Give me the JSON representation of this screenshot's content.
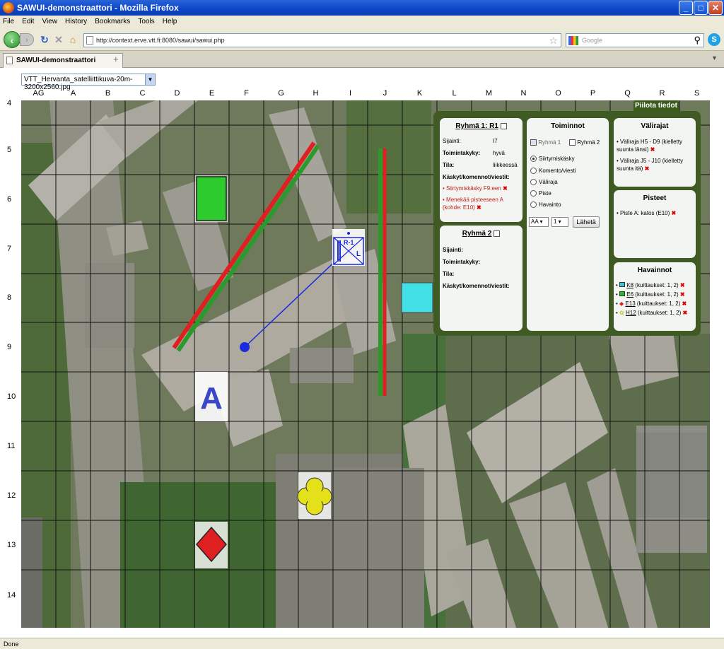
{
  "window": {
    "title": "SAWUI-demonstraattori - Mozilla Firefox",
    "min": "_",
    "max": "□",
    "close": "✕"
  },
  "menu": [
    "File",
    "Edit",
    "View",
    "History",
    "Bookmarks",
    "Tools",
    "Help"
  ],
  "nav": {
    "url": "http://context.erve.vtt.fi:8080/sawui/sawui.php",
    "search_placeholder": "Google"
  },
  "tab": {
    "label": "SAWUI-demonstraattori",
    "new_tab": "+"
  },
  "map_select": {
    "value": "VTT_Hervanta_satelliittikuva-20m-3200x2560.jpg"
  },
  "grid": {
    "columns": [
      "AG",
      "A",
      "B",
      "C",
      "D",
      "E",
      "F",
      "G",
      "H",
      "I",
      "J",
      "K",
      "L",
      "M",
      "N",
      "O",
      "P",
      "Q",
      "R",
      "S"
    ],
    "rows": [
      "4",
      "5",
      "6",
      "7",
      "8",
      "9",
      "10",
      "11",
      "12",
      "13",
      "14"
    ]
  },
  "panel": {
    "hide_label": "Piilota tiedot",
    "group1": {
      "title": "Ryhmä 1: R1",
      "location_label": "Sijainti:",
      "location": "I7",
      "capacity_label": "Toimintakyky:",
      "capacity": "hyvä",
      "state_label": "Tila:",
      "state": "liikkeessä",
      "orders_label": "Käskyt/komennot/viestit:",
      "orders": [
        "Siirtymiskäsky F9:een",
        "Menekää pisteeseen A (kohde: E10)"
      ]
    },
    "group2": {
      "title": "Ryhmä 2",
      "location_label": "Sijainti:",
      "capacity_label": "Toimintakyky:",
      "state_label": "Tila:",
      "orders_label": "Käskyt/komennot/viestit:"
    },
    "actions": {
      "title": "Toiminnot",
      "group1": "Ryhmä 1",
      "group2": "Ryhmä 2",
      "options": [
        "Siirtymiskäsky",
        "Komento/viesti",
        "Väliraja",
        "Piste",
        "Havainto"
      ],
      "col": "AA",
      "row": "1",
      "send": "Lähetä"
    },
    "boundaries": {
      "title": "Välirajat",
      "items": [
        "Väliraja H5 - D9 (kielletty suunta länsi)",
        "Väliraja J5 - J10 (kielletty suunta itä)"
      ]
    },
    "points": {
      "title": "Pisteet",
      "items": [
        "Piste A: katos (E10)"
      ]
    },
    "observations": {
      "title": "Havainnot",
      "items": [
        {
          "code": "K8",
          "text": "(kuittaukset: 1, 2)",
          "color": "#33cccc"
        },
        {
          "code": "E6",
          "text": "(kuittaukset: 1, 2)",
          "color": "#22bb22"
        },
        {
          "code": "E13",
          "text": "(kuittaukset: 1, 2)",
          "color": "#dd2222"
        },
        {
          "code": "H12",
          "text": "(kuittaukset: 1, 2)",
          "color": "#dddd22"
        }
      ]
    }
  },
  "map": {
    "unit_label": "R-1",
    "unit_suffix": "L",
    "point_label": "A"
  },
  "statusbar": {
    "text": "Done"
  }
}
